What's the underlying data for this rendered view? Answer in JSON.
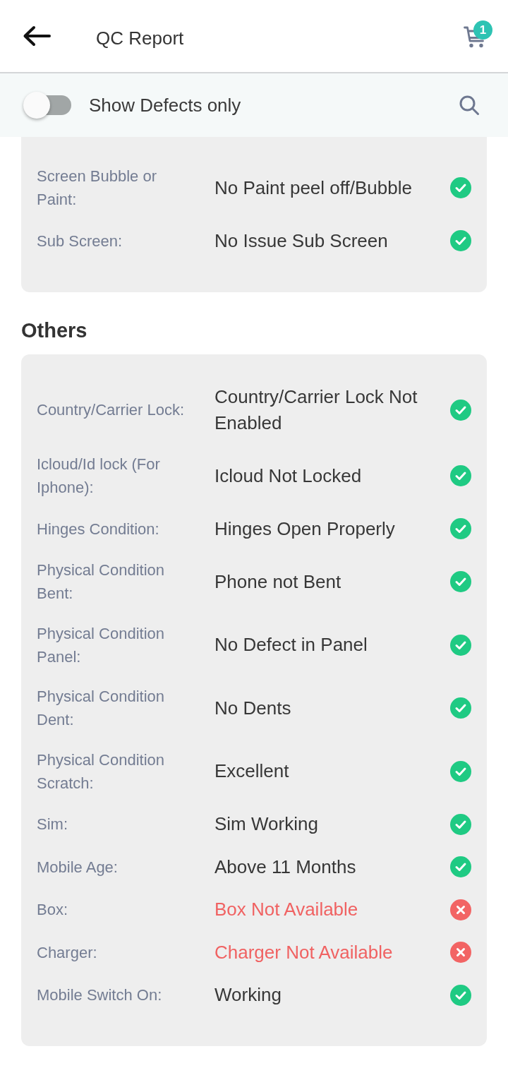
{
  "header": {
    "title": "QC Report",
    "cart_badge": "1"
  },
  "filter": {
    "label": "Show Defects only",
    "on": false
  },
  "sections": [
    {
      "rows": [
        {
          "label": "Screen Bubble or Paint:",
          "value": "No Paint peel off/Bubble",
          "defect": false
        },
        {
          "label": "Sub Screen:",
          "value": "No Issue Sub Screen",
          "defect": false
        }
      ]
    },
    {
      "title": "Others",
      "rows": [
        {
          "label": "Country/Carrier Lock:",
          "value": "Country/Carrier Lock Not Enabled",
          "defect": false
        },
        {
          "label": "Icloud/Id lock (For Iphone):",
          "value": "Icloud Not Locked",
          "defect": false
        },
        {
          "label": "Hinges Condition:",
          "value": "Hinges Open Properly",
          "defect": false
        },
        {
          "label": "Physical Condition Bent:",
          "value": "Phone not Bent",
          "defect": false
        },
        {
          "label": "Physical Condition Panel:",
          "value": "No Defect in Panel",
          "defect": false
        },
        {
          "label": "Physical Condition Dent:",
          "value": "No Dents",
          "defect": false
        },
        {
          "label": "Physical Condition Scratch:",
          "value": "Excellent",
          "defect": false
        },
        {
          "label": "Sim:",
          "value": "Sim Working",
          "defect": false
        },
        {
          "label": "Mobile Age:",
          "value": "Above 11 Months",
          "defect": false
        },
        {
          "label": "Box:",
          "value": "Box Not Available",
          "defect": true
        },
        {
          "label": "Charger:",
          "value": "Charger Not Available",
          "defect": true
        },
        {
          "label": "Mobile Switch On:",
          "value": "Working",
          "defect": false
        }
      ]
    }
  ]
}
